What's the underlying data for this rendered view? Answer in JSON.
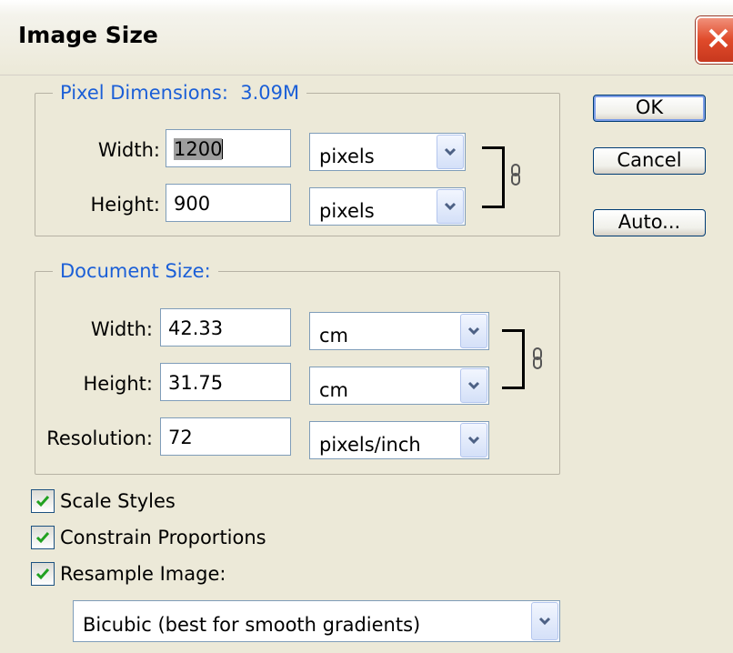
{
  "window": {
    "title": "Image Size"
  },
  "pixel_dimensions": {
    "label": "Pixel Dimensions:",
    "size": "3.09M",
    "width": {
      "label": "Width:",
      "value": "1200",
      "unit": "pixels"
    },
    "height": {
      "label": "Height:",
      "value": "900",
      "unit": "pixels"
    }
  },
  "document_size": {
    "label": "Document Size:",
    "width": {
      "label": "Width:",
      "value": "42.33",
      "unit": "cm"
    },
    "height": {
      "label": "Height:",
      "value": "31.75",
      "unit": "cm"
    },
    "resolution": {
      "label": "Resolution:",
      "value": "72",
      "unit": "pixels/inch"
    }
  },
  "buttons": {
    "ok": "OK",
    "cancel": "Cancel",
    "auto": "Auto..."
  },
  "options": {
    "scale_styles": {
      "label": "Scale Styles",
      "checked": true
    },
    "constrain_proportions": {
      "label": "Constrain Proportions",
      "checked": true
    },
    "resample_image": {
      "label": "Resample Image:",
      "checked": true
    },
    "resample_method": "Bicubic (best for smooth gradients)"
  },
  "colors": {
    "group_label": "#1B5FD7",
    "dialog_bg": "#ECE9D8",
    "close_button": "#E04A2A"
  }
}
